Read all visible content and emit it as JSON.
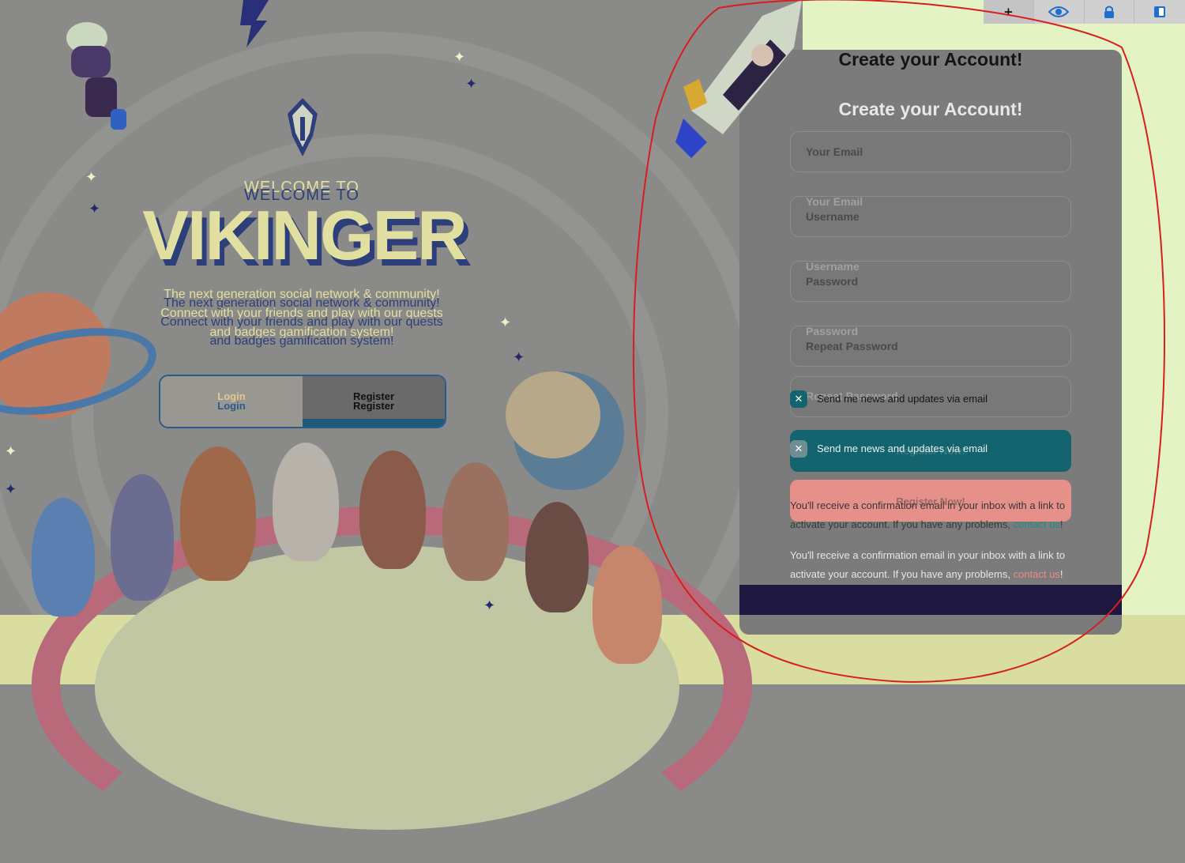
{
  "hero": {
    "welcome_front": "WELCOME TO",
    "welcome_back": "WELCOME TO",
    "brand": "VIKINGER",
    "tagline_front": [
      "The next generation social network & community!",
      "Connect with your friends and play with our quests",
      "and badges gamification system!"
    ],
    "tagline_back": [
      "The next generation social network & community!",
      "Connect with your friends and play with our quests",
      "and badges gamification system!"
    ]
  },
  "tabs": {
    "login_back": "Login",
    "login_front": "Login",
    "register_back": "Register",
    "register_front": "Register"
  },
  "form": {
    "title_back": "Create your Account!",
    "title_front": "Create your Account!",
    "fields": [
      {
        "placeholder": "Your Email"
      },
      {
        "placeholder": "Username"
      },
      {
        "placeholder": "Password"
      },
      {
        "placeholder": "Repeat Password"
      }
    ],
    "ghost_labels": [
      "Your Email",
      "Username",
      "Password",
      "Repeat Password"
    ],
    "newsletter_label_back": "Send me news and updates via email",
    "newsletter_label_front": "Send me news and updates via email",
    "submit_back": "Register Now!",
    "submit_front": "Register Now!",
    "note_back_text": "You'll receive a confirmation email in your inbox with a link to activate your account. If you have any problems, ",
    "note_back_link": "contact us",
    "note_back_end": "!",
    "note_front_text": "You'll receive a confirmation email in your inbox with a link to activate your account. If you have any problems, ",
    "note_front_link": "contact us",
    "note_front_end": "!"
  },
  "toolbar": {
    "items": [
      {
        "icon": "plus-icon",
        "label": "+"
      },
      {
        "icon": "eye-icon"
      },
      {
        "icon": "lock-icon"
      },
      {
        "icon": "panel-icon"
      }
    ]
  },
  "colors": {
    "accent_teal": "#13646e",
    "accent_pink": "#e6908a",
    "brand_yellow": "#e2e0a0",
    "brand_navy": "#2c3f7a",
    "annotation_red": "#d81e1e",
    "link_teal": "#1f8c90",
    "link_pink": "#f08a86"
  }
}
